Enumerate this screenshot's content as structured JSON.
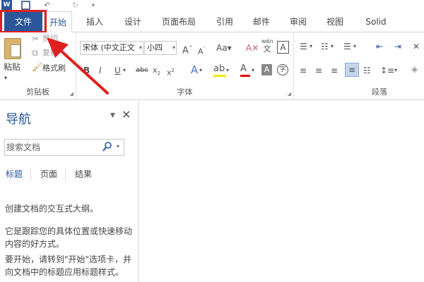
{
  "quick_access": {
    "word_icon": "word-logo-icon",
    "save_icon": "save-icon",
    "undo_icon": "undo-icon",
    "redo_icon": "redo-icon",
    "customize_icon": "customize-icon"
  },
  "tabs": {
    "file": "文件",
    "home": "开始",
    "insert": "插入",
    "design": "设计",
    "layout": "页面布局",
    "references": "引用",
    "mailings": "邮件",
    "review": "审阅",
    "view": "视图",
    "solid": "Solid"
  },
  "clipboard": {
    "paste": "粘贴",
    "cut": "剪切",
    "copy": "复制",
    "format_painter": "格式刷",
    "group_label": "剪贴板"
  },
  "font": {
    "font_name": "宋体 (中文正文",
    "font_size": "小四",
    "group_label": "字体",
    "wen_top": "wén",
    "wen_bottom": "文"
  },
  "paragraph": {
    "group_label": "段落"
  },
  "nav": {
    "title": "导航",
    "search_placeholder": "搜索文档",
    "tab_headings": "标题",
    "tab_pages": "页面",
    "tab_results": "结果",
    "text1": "创建文档的交互式大纲。",
    "text2": "它是跟踪您的具体位置或快速移动内容的好方式。",
    "text3": "要开始，请转到\"开始\"选项卡，并向文档中的标题应用标题样式。"
  },
  "colors": {
    "accent": "#2b579a",
    "highlight_box": "#e02020",
    "arrow": "#e02020"
  }
}
